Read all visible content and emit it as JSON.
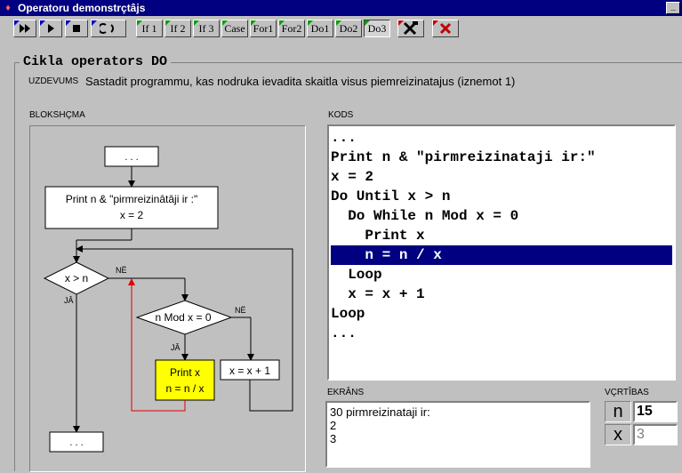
{
  "window": {
    "title": "Operatoru demonstrçtâjs",
    "min_glyph": "_"
  },
  "toolbar": {
    "buttons": [
      "If 1",
      "If 2",
      "If 3",
      "Case",
      "For1",
      "For2",
      "Do1",
      "Do2",
      "Do3"
    ]
  },
  "group_title": "Cikla operators DO",
  "task": {
    "label": "UZDEVUMS",
    "text": "Sastadit programmu, kas nodruka ievadita skaitla visus piemreizinatajus (iznemot 1)"
  },
  "flowchart": {
    "label": "BLOKSHÇMA",
    "start": ". . .",
    "print_line1": "Print n & \"pirmreizinâtâji ir :\"",
    "print_line2": "x = 2",
    "cond1": "x > n",
    "no1": "NË",
    "yes1": "JÂ",
    "cond2": "n Mod x = 0",
    "no2": "NË",
    "yes2": "JÂ",
    "action1_line1": "Print x",
    "action1_line2": "n = n / x",
    "action2": "x = x + 1",
    "end": ". . ."
  },
  "code": {
    "label": "KODS",
    "lines": [
      "...",
      "Print n & \"pirmreizinataji ir:\"",
      "x = 2",
      "Do Until x > n",
      "  Do While n Mod x = 0",
      "    Print x",
      "    n = n / x",
      "  Loop",
      "  x = x + 1",
      "Loop",
      "..."
    ],
    "highlight_index": 6
  },
  "screen": {
    "label": "EKRÂNS",
    "lines": [
      "30 pirmreizinataji ir:",
      "2",
      "3"
    ]
  },
  "values": {
    "label": "VÇRTÎBAS",
    "rows": [
      {
        "name": "n",
        "value": "15"
      },
      {
        "name": "x",
        "value": "3"
      }
    ]
  },
  "colors": {
    "title_bg": "#000080",
    "highlight": "#000080",
    "active_box": "#ffff00",
    "loop_arrow": "#e00000"
  }
}
